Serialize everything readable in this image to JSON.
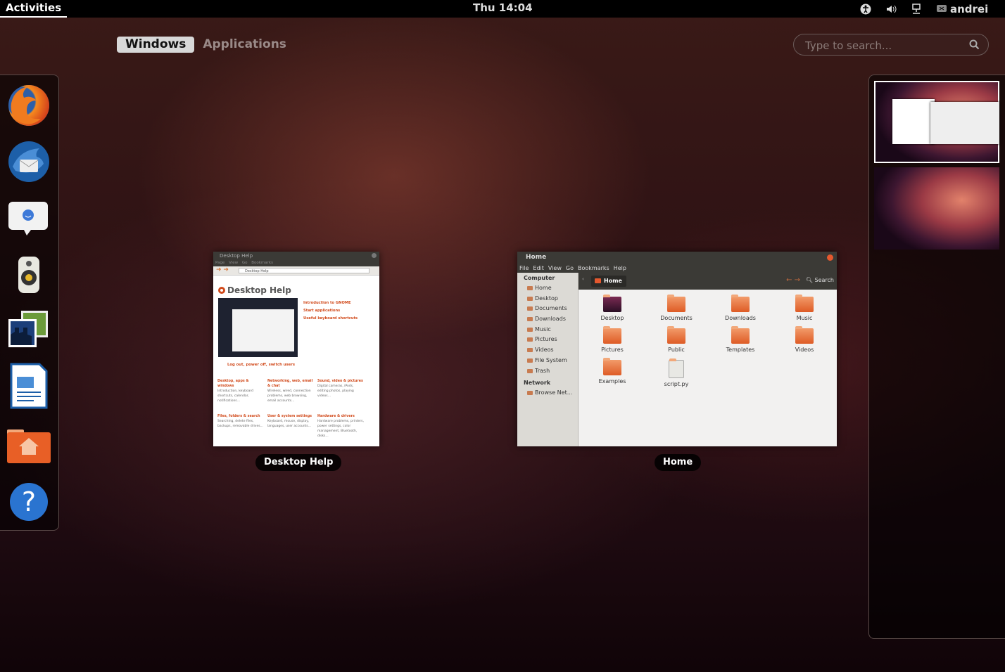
{
  "topbar": {
    "activities": "Activities",
    "clock": "Thu 14:04",
    "user": "andrei"
  },
  "view_selector": {
    "windows": "Windows",
    "applications": "Applications"
  },
  "search": {
    "placeholder": "Type to search..."
  },
  "dash": {
    "items": [
      "firefox-icon",
      "thunderbird-icon",
      "empathy-icon",
      "rhythmbox-icon",
      "shotwell-icon",
      "libreoffice-writer-icon",
      "home-folder-icon",
      "help-icon"
    ]
  },
  "windows": {
    "help": {
      "caption": "Desktop Help",
      "title": "Desktop Help",
      "menu": "Page View Go Bookmarks",
      "location": "Desktop Help",
      "heading": "Desktop Help",
      "links": [
        "Introduction to GNOME",
        "Start applications",
        "Useful keyboard shortcuts"
      ],
      "logout": "Log out, power off, switch users",
      "sections": [
        {
          "title": "Desktop, apps & windows",
          "body": "Introduction, keyboard shortcuts, calendar, notifications..."
        },
        {
          "title": "Networking, web, email & chat",
          "body": "Wireless, wired, connection problems, web browsing, email accounts..."
        },
        {
          "title": "Sound, video & pictures",
          "body": "Digital cameras, iPods, editing photos, playing videos..."
        },
        {
          "title": "Files, folders & search",
          "body": "Searching, delete files, backups, removable drives..."
        },
        {
          "title": "User & system settings",
          "body": "Keyboard, mouse, display, languages, user accounts..."
        },
        {
          "title": "Hardware & drivers",
          "body": "Hardware problems, printers, power settings, color management, Bluetooth, disks..."
        }
      ]
    },
    "home": {
      "caption": "Home",
      "title": "Home",
      "menu": [
        "File",
        "Edit",
        "View",
        "Go",
        "Bookmarks",
        "Help"
      ],
      "sidebar": {
        "computer_header": "Computer",
        "computer_items": [
          "Home",
          "Desktop",
          "Documents",
          "Downloads",
          "Music",
          "Pictures",
          "Videos",
          "File System",
          "Trash"
        ],
        "network_header": "Network",
        "network_items": [
          "Browse Net..."
        ]
      },
      "crumb": "Home",
      "search_label": "Search",
      "files": [
        "Desktop",
        "Documents",
        "Downloads",
        "Music",
        "Pictures",
        "Public",
        "Templates",
        "Videos",
        "Examples",
        "script.py"
      ]
    }
  },
  "workspaces": [
    "workspace-1",
    "workspace-2"
  ]
}
